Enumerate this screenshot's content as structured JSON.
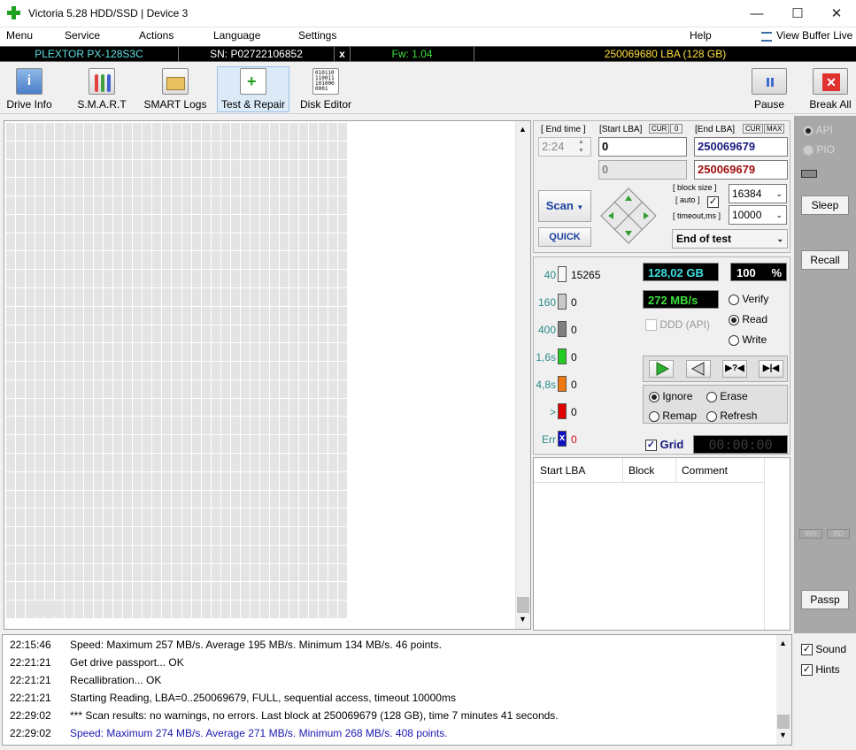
{
  "window": {
    "title": "Victoria 5.28 HDD/SSD | Device 3"
  },
  "menu": {
    "items": [
      "Menu",
      "Service",
      "Actions",
      "Language",
      "Settings"
    ],
    "help": "Help",
    "view_buffer": "View Buffer Live"
  },
  "device": {
    "model": "PLEXTOR PX-128S3C",
    "serial": "SN: P02722106852",
    "close": "x",
    "firmware": "Fw: 1.04",
    "capacity": "250069680 LBA (128 GB)"
  },
  "toolbar": {
    "drive_info": "Drive Info",
    "smart": "S.M.A.R.T",
    "smart_logs": "SMART Logs",
    "test_repair": "Test & Repair",
    "disk_editor": "Disk Editor",
    "pause": "Pause",
    "break_all": "Break All",
    "disk_editor_bits": "010110\n110011\n101000\n0001"
  },
  "scan": {
    "end_time_label": "[ End time ]",
    "end_time": "2:24",
    "start_lba_label": "[Start LBA]",
    "cur": "CUR",
    "zero": "0",
    "end_lba_label": "[End LBA]",
    "max": "MAX",
    "start_lba": "0",
    "end_lba": "250069679",
    "start_lba_2": "0",
    "end_lba_2": "250069679",
    "block_size_label": "[ block size ]",
    "auto_label": "[ auto ]",
    "timeout_label": "[ timeout,ms ]",
    "block_size": "16384",
    "timeout": "10000",
    "scan_button": "Scan",
    "quick_button": "QUICK",
    "end_of_test": "End of test"
  },
  "stats": {
    "legend": [
      {
        "label": "40",
        "count": "15265",
        "color": "#f8f8f8"
      },
      {
        "label": "160",
        "count": "0",
        "color": "#c8c8c8"
      },
      {
        "label": "400",
        "count": "0",
        "color": "#808080"
      },
      {
        "label": "1,6s",
        "count": "0",
        "color": "#22cc22"
      },
      {
        "label": "4,8s",
        "count": "0",
        "color": "#f07810"
      },
      {
        "label": ">",
        "count": "0",
        "color": "#e00000"
      },
      {
        "label": "Err",
        "count": "0",
        "color": "#1010c0"
      }
    ],
    "err_mark": "x",
    "size": "128,02 GB",
    "percent": "100",
    "percent_sign": "%",
    "speed": "272 MB/s",
    "ddd": "DDD (API)",
    "verify": "Verify",
    "read": "Read",
    "write": "Write",
    "ignore": "Ignore",
    "erase": "Erase",
    "remap": "Remap",
    "refresh": "Refresh",
    "grid": "Grid",
    "timer": "00:00:00"
  },
  "table": {
    "headers": [
      "Start LBA",
      "Block",
      "Comment"
    ]
  },
  "sidebar": {
    "api": "API",
    "pio": "PIO",
    "sleep": "Sleep",
    "recall": "Recall",
    "wr": "WR",
    "rd": "RD",
    "passp": "Passp",
    "sound": "Sound",
    "hints": "Hints"
  },
  "log": [
    {
      "time": "22:15:46",
      "text": "Speed: Maximum 257 MB/s. Average 195 MB/s. Minimum 134 MB/s. 46 points.",
      "color": "#000000"
    },
    {
      "time": "22:21:21",
      "text": "Get drive passport... OK",
      "color": "#000000"
    },
    {
      "time": "22:21:21",
      "text": "Recallibration... OK",
      "color": "#000000"
    },
    {
      "time": "22:21:21",
      "text": "Starting Reading, LBA=0..250069679, FULL, sequential access, timeout 10000ms",
      "color": "#000000"
    },
    {
      "time": "22:29:02",
      "text": "*** Scan results: no warnings, no errors. Last block at 250069679 (128 GB), time 7 minutes 41 seconds.",
      "color": "#000000"
    },
    {
      "time": "22:29:02",
      "text": "Speed: Maximum 274 MB/s. Average 271 MB/s. Minimum 268 MB/s. 408 points.",
      "color": "#1a1ab0"
    }
  ]
}
